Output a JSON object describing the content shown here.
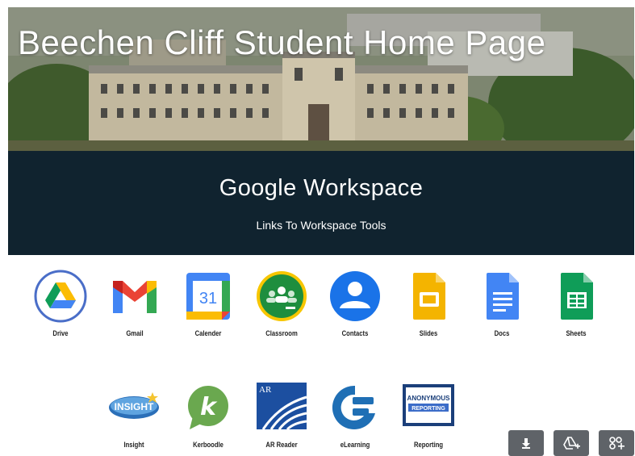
{
  "hero": {
    "title": "Beechen Cliff Student Home Page"
  },
  "section": {
    "title": "Google Workspace",
    "subtitle": "Links To Workspace Tools"
  },
  "apps_row1": [
    {
      "label": "Drive",
      "icon": "google-drive-icon"
    },
    {
      "label": "Gmail",
      "icon": "gmail-icon"
    },
    {
      "label": "Calender",
      "icon": "google-calendar-icon"
    },
    {
      "label": "Classroom",
      "icon": "google-classroom-icon"
    },
    {
      "label": "Contacts",
      "icon": "google-contacts-icon"
    },
    {
      "label": "Slides",
      "icon": "google-slides-icon"
    },
    {
      "label": "Docs",
      "icon": "google-docs-icon"
    },
    {
      "label": "Sheets",
      "icon": "google-sheets-icon"
    }
  ],
  "apps_row2": [
    {
      "label": "Insight",
      "icon": "insight-icon",
      "logo_text": "INSIGHT"
    },
    {
      "label": "Kerboodle",
      "icon": "kerboodle-icon",
      "logo_text": "k"
    },
    {
      "label": "AR Reader",
      "icon": "accelerated-reader-icon",
      "logo_text": "AR"
    },
    {
      "label": "eLearning",
      "icon": "elearning-icon"
    },
    {
      "label": "Reporting",
      "icon": "anonymous-reporting-icon",
      "logo_text_1": "ANONYMOUS",
      "logo_text_2": "REPORTING"
    }
  ],
  "calendar_day": "31",
  "actions": [
    {
      "icon": "download-icon"
    },
    {
      "icon": "add-to-drive-icon"
    },
    {
      "icon": "add-shortcut-icon"
    }
  ],
  "colors": {
    "section_bg": "#10232f",
    "action_bg": "#5f6368"
  }
}
